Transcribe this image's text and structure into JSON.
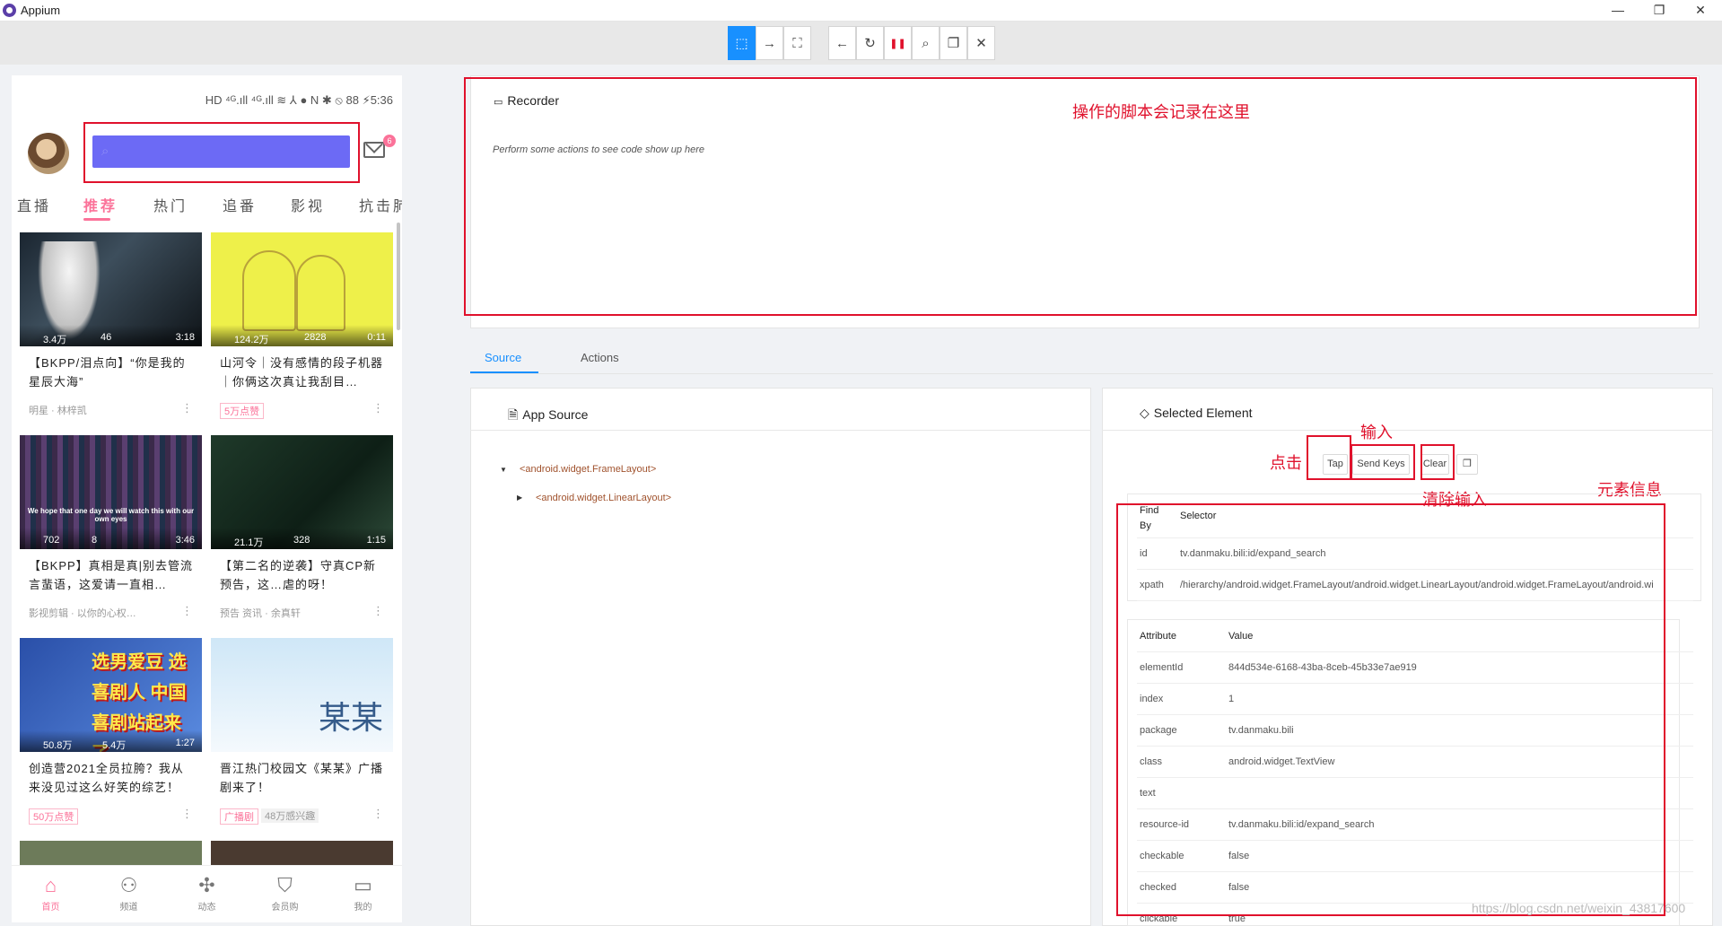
{
  "window": {
    "title": "Appium",
    "minimize": "—",
    "restore": "❐",
    "close": "✕"
  },
  "toolbar": {
    "select": "⬚",
    "swipe": "→",
    "tap_coords": "⛶",
    "back": "←",
    "refresh": "↻",
    "pause": "❚❚",
    "search": "⌕",
    "copy": "❐",
    "quit": "✕"
  },
  "phone": {
    "status": "HD ⁴ᴳ.ıll ⁴ᴳ.ıll ≋ ⅄ ● N ✱ ⦸ 88 ⚡5:36",
    "mail_badge": "6",
    "tabs": [
      "直播",
      "推荐",
      "热门",
      "追番",
      "影视",
      "抗击肺"
    ],
    "cards": [
      {
        "views": "3.4万",
        "danmaku": "46",
        "duration": "3:18",
        "title": "【BKPP/泪点向】“你是我的星辰大海”",
        "foot": "明星 · 林梓凯",
        "foot_tag": false
      },
      {
        "views": "124.2万",
        "danmaku": "2828",
        "duration": "0:11",
        "title": "山河令｜没有感情的段子机器｜你俩这次真让我刮目…",
        "foot": "5万点赞",
        "foot_tag": true
      },
      {
        "views": "702",
        "danmaku": "8",
        "duration": "3:46",
        "title": "【BKPP】真相是真|别去管流言蜚语，这爱请一直相…",
        "foot": "影视剪辑 · 以你的心权…",
        "foot_tag": false,
        "thumb_text": "We hope that one day we will watch this with our own eyes"
      },
      {
        "views": "21.1万",
        "danmaku": "328",
        "duration": "1:15",
        "title": "【第二名的逆袭】守真CP新预告，这…虐的呀！",
        "foot": "预告 资讯 · 余真轩",
        "foot_tag": false
      },
      {
        "views": "50.8万",
        "danmaku": "5.4万",
        "duration": "1:27",
        "title": "创造营2021全员拉胯？我从来没见过这么好笑的综艺！",
        "foot": "50万点赞",
        "foot_tag": true,
        "thumb_text": "选男爱豆 选喜剧人 中国喜剧站起来了"
      },
      {
        "views": "",
        "danmaku": "",
        "duration": "",
        "title": "晋江热门校园文《某某》广播剧来了！",
        "foot": "广播剧",
        "foot_tag": true,
        "foot2": "48万感兴趣",
        "thumb_text": "某某"
      }
    ],
    "bottom_nav": [
      {
        "icon": "⌂",
        "label": "首页"
      },
      {
        "icon": "⚇",
        "label": "频道"
      },
      {
        "icon": "✣",
        "label": "动态"
      },
      {
        "icon": "⛉",
        "label": "会员购"
      },
      {
        "icon": "▭",
        "label": "我的"
      }
    ]
  },
  "recorder": {
    "icon": "▭",
    "title": "Recorder",
    "message": "Perform some actions to see code show up here",
    "note": "操作的脚本会记录在这里"
  },
  "inspector_tabs": {
    "source": "Source",
    "actions": "Actions"
  },
  "app_source": {
    "icon": "🗎",
    "title": "App Source",
    "nodes": [
      "<android.widget.FrameLayout>",
      "<android.widget.LinearLayout>"
    ]
  },
  "selected": {
    "icon": "◇",
    "title": "Selected Element",
    "tap": "Tap",
    "send_keys": "Send Keys",
    "clear": "Clear",
    "copy": "❐",
    "notes": {
      "tap": "点击",
      "input": "输入",
      "clear": "清除输入",
      "info": "元素信息"
    },
    "selector_headers": {
      "find_by": "Find By",
      "selector": "Selector"
    },
    "selectors": [
      {
        "by": "id",
        "value": "tv.danmaku.bili:id/expand_search"
      },
      {
        "by": "xpath",
        "value": "/hierarchy/android.widget.FrameLayout/android.widget.LinearLayout/android.widget.FrameLayout/android.wi"
      }
    ],
    "attr_headers": {
      "attribute": "Attribute",
      "value": "Value"
    },
    "attributes": [
      {
        "name": "elementId",
        "value": "844d534e-6168-43ba-8ceb-45b33e7ae919"
      },
      {
        "name": "index",
        "value": "1"
      },
      {
        "name": "package",
        "value": "tv.danmaku.bili"
      },
      {
        "name": "class",
        "value": "android.widget.TextView"
      },
      {
        "name": "text",
        "value": ""
      },
      {
        "name": "resource-id",
        "value": "tv.danmaku.bili:id/expand_search"
      },
      {
        "name": "checkable",
        "value": "false"
      },
      {
        "name": "checked",
        "value": "false"
      },
      {
        "name": "clickable",
        "value": "true"
      }
    ]
  },
  "watermark": "https://blog.csdn.net/weixin_43817600"
}
